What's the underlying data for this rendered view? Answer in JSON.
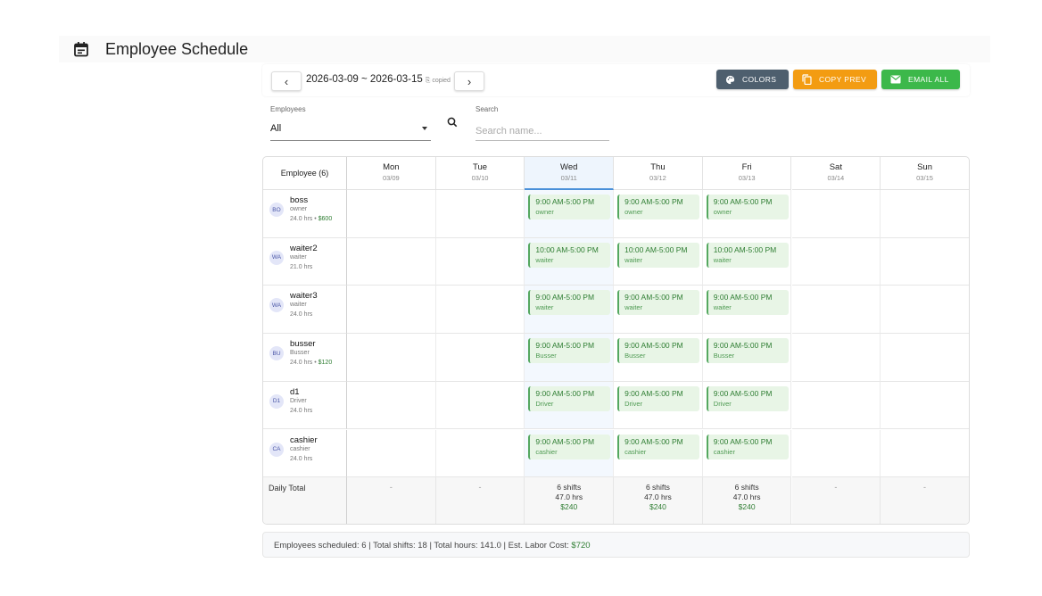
{
  "app": {
    "title": "Employee Schedule",
    "icon": "calendar-icon"
  },
  "toolbar": {
    "prev_icon": "chevron-left-icon",
    "next_icon": "chevron-right-icon",
    "prev_label": "‹",
    "next_label": "›",
    "date_range": "2026-03-09 ~ 2026-03-15",
    "copied_label": "copied",
    "colors_label": "COLORS",
    "copy_prev_label": "COPY PREV",
    "email_all_label": "EMAIL ALL",
    "colors_btn_color": "#4e5f6e",
    "copy_prev_btn_color": "#f39c12",
    "email_all_btn_color": "#3cb84a"
  },
  "filters": {
    "employees_label": "Employees",
    "employees_value": "All",
    "search_label": "Search",
    "search_placeholder": "Search name..."
  },
  "grid": {
    "employee_header": "Employee (6)",
    "days": [
      {
        "name": "Mon",
        "date": "03/09",
        "today": false
      },
      {
        "name": "Tue",
        "date": "03/10",
        "today": false
      },
      {
        "name": "Wed",
        "date": "03/11",
        "today": true
      },
      {
        "name": "Thu",
        "date": "03/12",
        "today": false
      },
      {
        "name": "Fri",
        "date": "03/13",
        "today": false
      },
      {
        "name": "Sat",
        "date": "03/14",
        "today": false
      },
      {
        "name": "Sun",
        "date": "03/15",
        "today": false
      }
    ],
    "employees": [
      {
        "initials": "BO",
        "name": "boss",
        "role": "owner",
        "hours": "24.0 hrs",
        "cost": "$600",
        "shifts": [
          null,
          null,
          {
            "time": "9:00 AM-5:00 PM",
            "role": "owner"
          },
          {
            "time": "9:00 AM-5:00 PM",
            "role": "owner"
          },
          {
            "time": "9:00 AM-5:00 PM",
            "role": "owner"
          },
          null,
          null
        ]
      },
      {
        "initials": "WA",
        "name": "waiter2",
        "role": "waiter",
        "hours": "21.0 hrs",
        "cost": "",
        "shifts": [
          null,
          null,
          {
            "time": "10:00 AM-5:00 PM",
            "role": "waiter"
          },
          {
            "time": "10:00 AM-5:00 PM",
            "role": "waiter"
          },
          {
            "time": "10:00 AM-5:00 PM",
            "role": "waiter"
          },
          null,
          null
        ]
      },
      {
        "initials": "WA",
        "name": "waiter3",
        "role": "waiter",
        "hours": "24.0 hrs",
        "cost": "",
        "shifts": [
          null,
          null,
          {
            "time": "9:00 AM-5:00 PM",
            "role": "waiter"
          },
          {
            "time": "9:00 AM-5:00 PM",
            "role": "waiter"
          },
          {
            "time": "9:00 AM-5:00 PM",
            "role": "waiter"
          },
          null,
          null
        ]
      },
      {
        "initials": "BU",
        "name": "busser",
        "role": "Busser",
        "hours": "24.0 hrs",
        "cost": "$120",
        "shifts": [
          null,
          null,
          {
            "time": "9:00 AM-5:00 PM",
            "role": "Busser"
          },
          {
            "time": "9:00 AM-5:00 PM",
            "role": "Busser"
          },
          {
            "time": "9:00 AM-5:00 PM",
            "role": "Busser"
          },
          null,
          null
        ]
      },
      {
        "initials": "D1",
        "name": "d1",
        "role": "Driver",
        "hours": "24.0 hrs",
        "cost": "",
        "shifts": [
          null,
          null,
          {
            "time": "9:00 AM-5:00 PM",
            "role": "Driver"
          },
          {
            "time": "9:00 AM-5:00 PM",
            "role": "Driver"
          },
          {
            "time": "9:00 AM-5:00 PM",
            "role": "Driver"
          },
          null,
          null
        ]
      },
      {
        "initials": "CA",
        "name": "cashier",
        "role": "cashier",
        "hours": "24.0 hrs",
        "cost": "",
        "shifts": [
          null,
          null,
          {
            "time": "9:00 AM-5:00 PM",
            "role": "cashier"
          },
          {
            "time": "9:00 AM-5:00 PM",
            "role": "cashier"
          },
          {
            "time": "9:00 AM-5:00 PM",
            "role": "cashier"
          },
          null,
          null
        ]
      }
    ],
    "daily_total_label": "Daily Total",
    "daily_totals": [
      {
        "empty": "-"
      },
      {
        "empty": "-"
      },
      {
        "shifts": "6 shifts",
        "hours": "47.0 hrs",
        "cost": "$240"
      },
      {
        "shifts": "6 shifts",
        "hours": "47.0 hrs",
        "cost": "$240"
      },
      {
        "shifts": "6 shifts",
        "hours": "47.0 hrs",
        "cost": "$240"
      },
      {
        "empty": "-"
      },
      {
        "empty": "-"
      }
    ],
    "shift_color": "#e8f5e6",
    "today_color": "#f3f8fe"
  },
  "footer": {
    "summary": "Employees scheduled: 6  |  Total shifts: 18  |  Total hours: 141.0  |  Est. Labor Cost: ",
    "labor_cost": "$720"
  }
}
